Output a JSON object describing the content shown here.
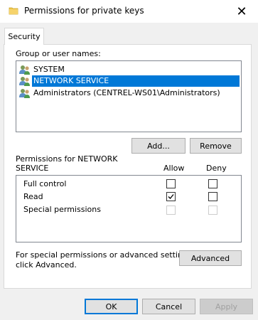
{
  "window": {
    "title": "Permissions for private keys",
    "close_glyph": "✕",
    "title_icon": "folder-icon"
  },
  "tabs": [
    {
      "label": "Security",
      "active": true
    }
  ],
  "group_section": {
    "label": "Group or user names:",
    "items": [
      {
        "name": "SYSTEM",
        "icon": "users-group-icon",
        "selected": false
      },
      {
        "name": "NETWORK SERVICE",
        "icon": "users-group-icon",
        "selected": true
      },
      {
        "name": "Administrators (CENTREL-WS01\\Administrators)",
        "icon": "users-group-icon",
        "selected": false
      }
    ],
    "add_label": "Add...",
    "remove_label": "Remove"
  },
  "permissions": {
    "label_line1": "Permissions for NETWORK",
    "label_line2": "SERVICE",
    "allow_header": "Allow",
    "deny_header": "Deny",
    "rows": [
      {
        "name": "Full control",
        "allow": false,
        "deny": false,
        "enabled": true
      },
      {
        "name": "Read",
        "allow": true,
        "deny": false,
        "enabled": true
      },
      {
        "name": "Special permissions",
        "allow": false,
        "deny": false,
        "enabled": false
      }
    ]
  },
  "advanced": {
    "text_line1": "For special permissions or advanced settings,",
    "text_line2": "click Advanced.",
    "button_label": "Advanced"
  },
  "footer": {
    "ok_label": "OK",
    "cancel_label": "Cancel",
    "apply_label": "Apply"
  },
  "colors": {
    "selection": "#0078d7",
    "default_button_border": "#0078d7",
    "folder_yellow": "#f2c94c"
  }
}
